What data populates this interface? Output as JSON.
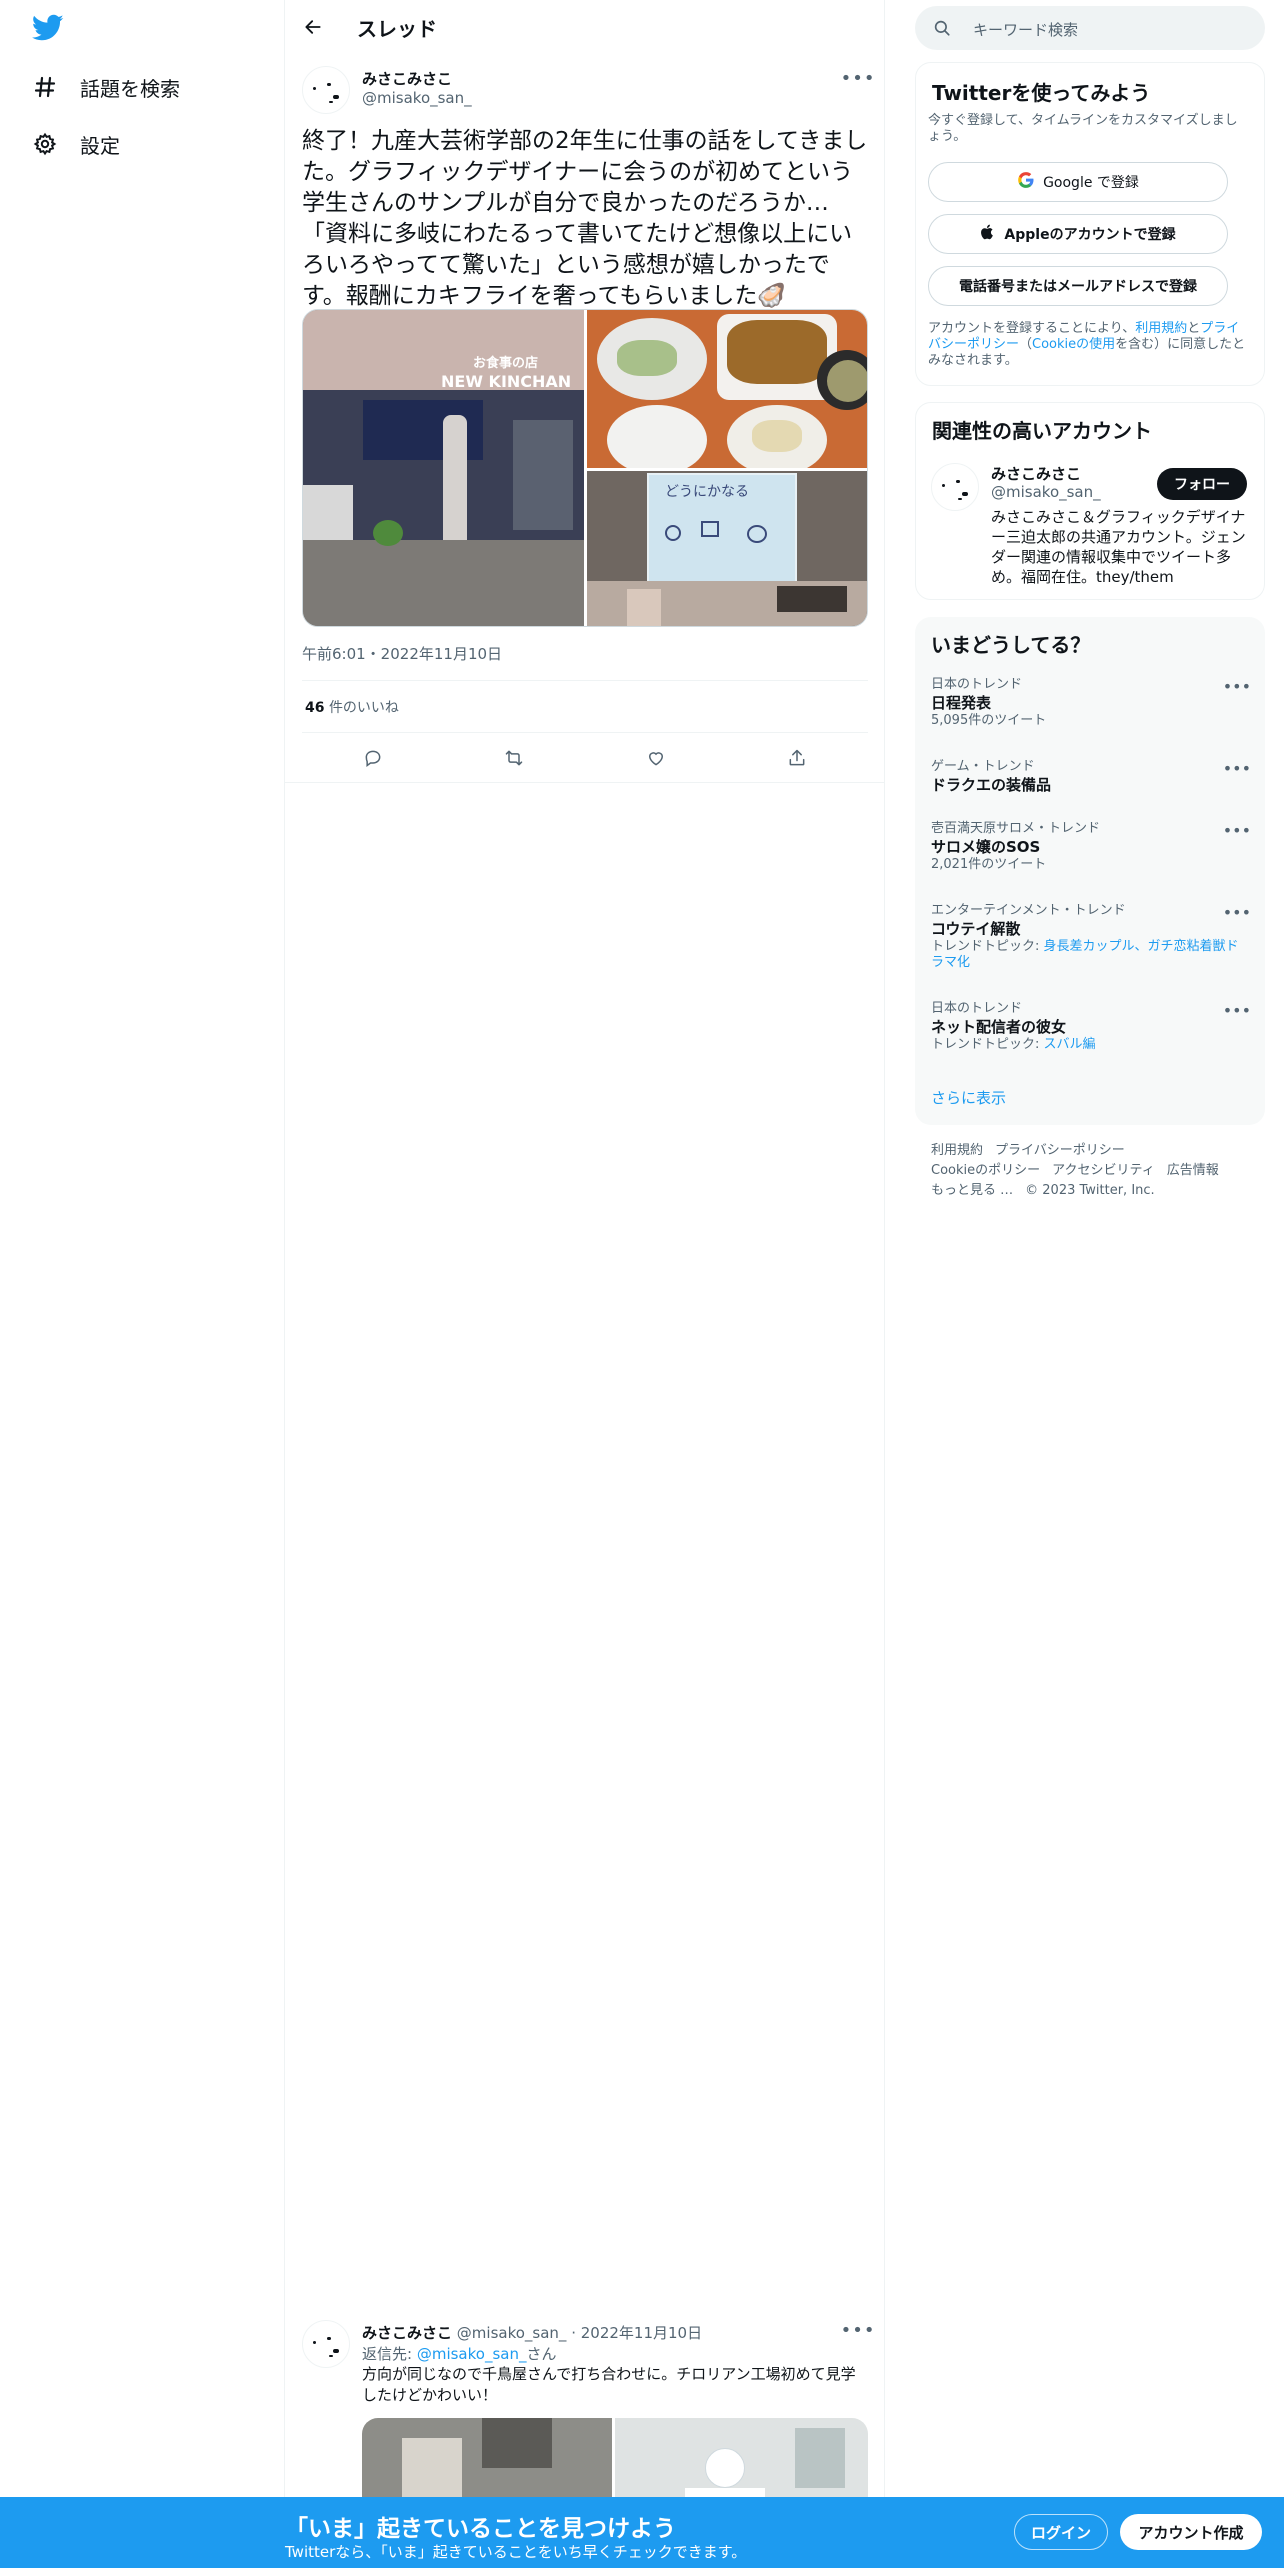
{
  "nav": {
    "logo": "twitter-bird-icon",
    "items": [
      {
        "icon": "hashtag-icon",
        "label": "話題を検索"
      },
      {
        "icon": "gear-icon",
        "label": "設定"
      }
    ]
  },
  "header": {
    "title": "スレッド"
  },
  "tweet": {
    "name": "みさこみさこ",
    "handle": "@misako_san_",
    "text": "終了！九産大芸術学部の2年生に仕事の話をしてきました。グラフィックデザイナーに会うのが初めてという学生さんのサンプルが自分で良かったのだろうか…「資料に多岐にわたるって書いてたけど想像以上にいろいろやってて驚いた」という感想が嬉しかったです。報酬にカキフライを奢ってもらいました🦪",
    "photo_sign_1": "お食事の店",
    "photo_sign_2": "NEW KINCHAN",
    "photo_board_text": "どうにかなる",
    "time": "午前6:01・2022年11月10日",
    "likes_count": "46",
    "likes_label": "件のいいね"
  },
  "reply": {
    "name": "みさこみさこ",
    "meta": "@misako_san_ · 2022年11月10日",
    "reply_prefix": "返信先: ",
    "reply_target": "@misako_san_",
    "reply_suffix": "さん",
    "text": "方向が同じなので千鳥屋さんで打ち合わせに。チロリアン工場初めて見学したけどかわいい！"
  },
  "search": {
    "placeholder": "キーワード検索"
  },
  "signup_card": {
    "title": "Twitterを使ってみよう",
    "subtitle": "今すぐ登録して、タイムラインをカスタマイズしましょう。",
    "google_label": "Google で登録",
    "apple_label": "Appleのアカウントで登録",
    "phone_label": "電話番号またはメールアドレスで登録",
    "legal_1": "アカウントを登録することにより、",
    "legal_terms": "利用規約",
    "legal_and": "と",
    "legal_privacy": "プライバシーポリシー",
    "legal_paren_open": "（",
    "legal_cookie": "Cookieの使用",
    "legal_rest": "を含む）に同意したとみなされます。"
  },
  "related": {
    "title": "関連性の高いアカウント",
    "name": "みさこみさこ",
    "handle": "@misako_san_",
    "follow_label": "フォロー",
    "bio": "みさこみさこ＆グラフィックデザイナー三迫太郎の共通アカウント。ジェンダー関連の情報収集中でツイート多め。福岡在住。they/them"
  },
  "trends": {
    "title": "いまどうしてる？",
    "items": [
      {
        "context": "日本のトレンド",
        "name": "日程発表",
        "count": "5,095件のツイート",
        "topics_label": "",
        "topics": ""
      },
      {
        "context": "ゲーム・トレンド",
        "name": "ドラクエの装備品",
        "count": "",
        "topics_label": "",
        "topics": ""
      },
      {
        "context": "壱百満天原サロメ・トレンド",
        "name": "サロメ嬢のSOS",
        "count": "2,021件のツイート",
        "topics_label": "",
        "topics": ""
      },
      {
        "context": "エンターテインメント・トレンド",
        "name": "コウテイ解散",
        "count": "",
        "topics_label": "トレンドトピック: ",
        "topics": "身長差カップル、ガチ恋粘着獣ドラマ化"
      },
      {
        "context": "日本のトレンド",
        "name": "ネット配信者の彼女",
        "count": "",
        "topics_label": "トレンドトピック: ",
        "topics": "スバル編"
      }
    ],
    "show_more": "さらに表示"
  },
  "footer": {
    "terms": "利用規約",
    "privacy": "プライバシーポリシー",
    "cookie": "Cookieのポリシー",
    "accessibility": "アクセシビリティ",
    "ads": "広告情報",
    "more": "もっと見る …",
    "copyright": "© 2023 Twitter, Inc."
  },
  "bottombar": {
    "title": "「いま」起きていることを見つけよう",
    "subtitle": "Twitterなら、「いま」起きていることをいち早くチェックできます。",
    "login": "ログイン",
    "signup": "アカウント作成"
  },
  "colors": {
    "accent": "#1d9bf0",
    "text": "#0f1419",
    "muted": "#536471",
    "border": "#eff3f4"
  }
}
